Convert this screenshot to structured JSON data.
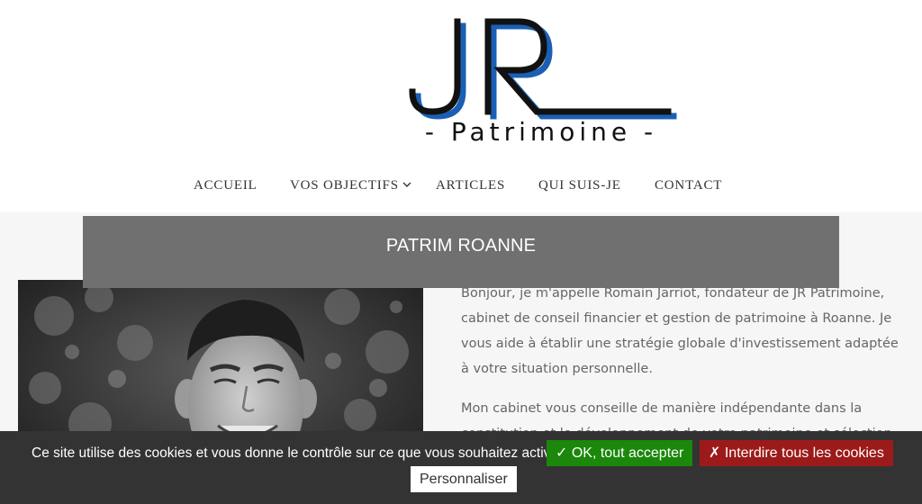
{
  "logo": {
    "monogram": "JR",
    "subtitle": "- Patrimoine -",
    "accent_color": "#1a5fb4"
  },
  "nav": {
    "items": [
      {
        "label": "ACCUEIL"
      },
      {
        "label": "VOS OBJECTIFS",
        "has_submenu": true,
        "icon": "chevron-down-icon"
      },
      {
        "label": "ARTICLES"
      },
      {
        "label": "QUI SUIS-JE"
      },
      {
        "label": "CONTACT"
      }
    ]
  },
  "banner": {
    "title": "PATRIM ROANNE",
    "color": "#707070"
  },
  "photo": {
    "alt": "portrait"
  },
  "content": {
    "paragraph_1": "Bonjour, je m'appelle Romain Jarriot, fondateur de JR Patrimoine, cabinet de conseil financier et gestion de patrimoine à Roanne. Je vous aide à établir une stratégie globale d'investissement adaptée à votre situation personnelle.",
    "paragraph_2": "Mon cabinet vous conseille de manière indépendante dans la constitution et le développement de votre patrimoine et sélection"
  },
  "cookies": {
    "message": "Ce site utilise des cookies et vous donne le contrôle sur ce que vous souhaitez activer",
    "accept_label": "✓ OK, tout accepter",
    "deny_label": "✗ Interdire tous les cookies",
    "customize_label": "Personnaliser",
    "accept_color": "#1b870b",
    "deny_color": "#9c1a1a"
  }
}
